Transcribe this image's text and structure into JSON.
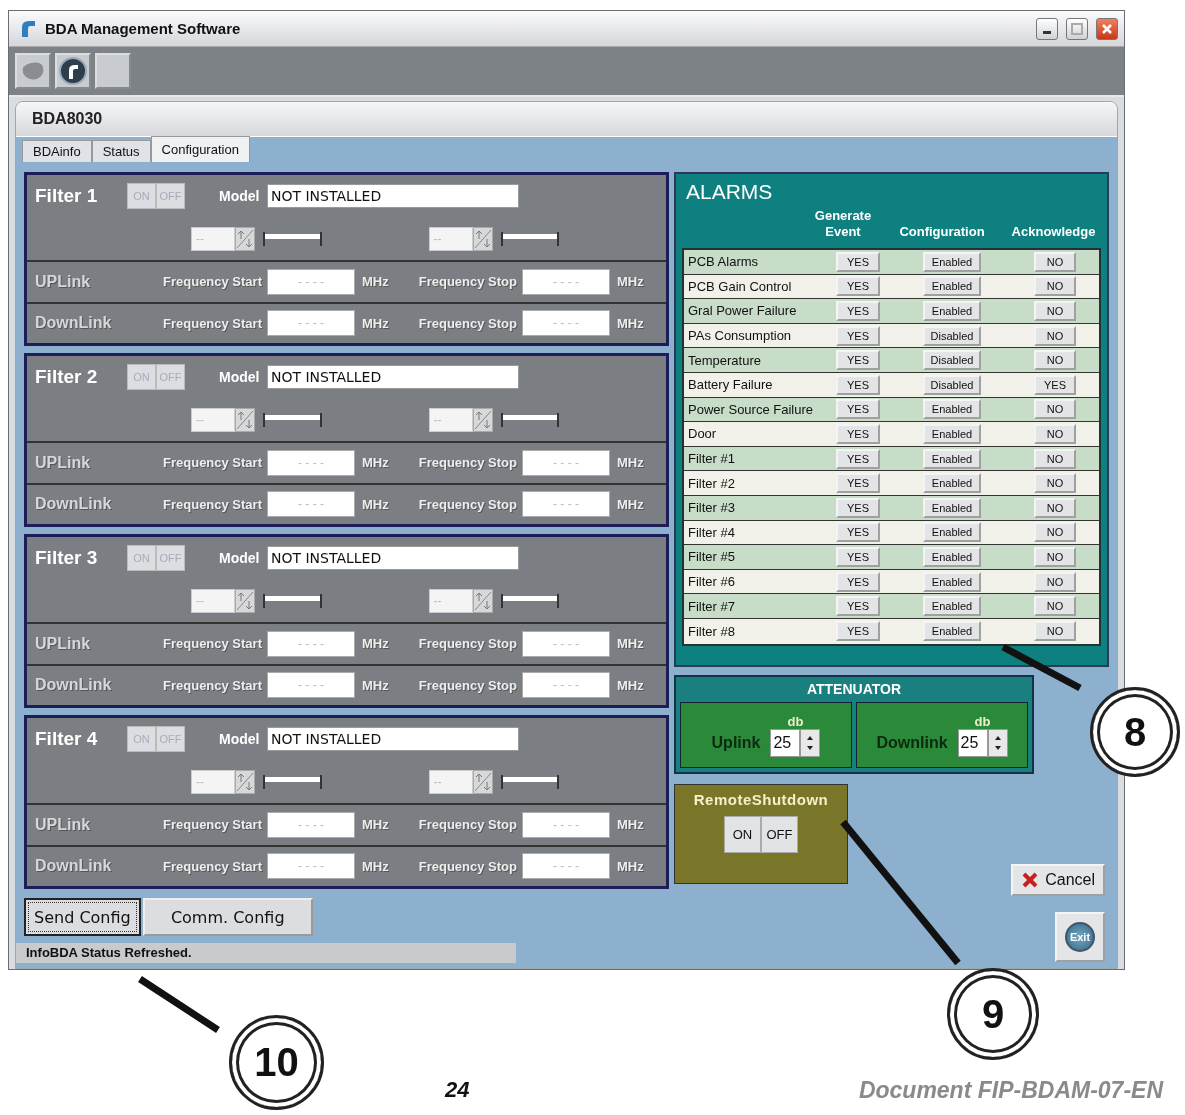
{
  "window": {
    "title": "BDA Management Software"
  },
  "form": {
    "title": "BDA8030"
  },
  "tabs": [
    {
      "label": "BDAinfo",
      "selected": false
    },
    {
      "label": "Status",
      "selected": false
    },
    {
      "label": "Configuration",
      "selected": true
    }
  ],
  "filters": [
    {
      "title": "Filter 1",
      "switch": [
        "ON",
        "OFF"
      ],
      "model_label": "Model",
      "model": "NOT INSTALLED",
      "spinners": [
        "--",
        "--"
      ],
      "links": [
        {
          "label": "UPLink",
          "start_label": "Frequency Start",
          "start": "- - - -",
          "start_unit": "MHz",
          "stop_label": "Frequency Stop",
          "stop": "- - - -",
          "stop_unit": "MHz"
        },
        {
          "label": "DownLink",
          "start_label": "Frequency Start",
          "start": "- - - -",
          "start_unit": "MHz",
          "stop_label": "Frequency Stop",
          "stop": "- - - -",
          "stop_unit": "MHz"
        }
      ]
    },
    {
      "title": "Filter 2",
      "switch": [
        "ON",
        "OFF"
      ],
      "model_label": "Model",
      "model": "NOT INSTALLED",
      "spinners": [
        "--",
        "--"
      ],
      "links": [
        {
          "label": "UPLink",
          "start_label": "Frequency Start",
          "start": "- - - -",
          "start_unit": "MHz",
          "stop_label": "Frequency Stop",
          "stop": "- - - -",
          "stop_unit": "MHz"
        },
        {
          "label": "DownLink",
          "start_label": "Frequency Start",
          "start": "- - - -",
          "start_unit": "MHz",
          "stop_label": "Frequency Stop",
          "stop": "- - - -",
          "stop_unit": "MHz"
        }
      ]
    },
    {
      "title": "Filter 3",
      "switch": [
        "ON",
        "OFF"
      ],
      "model_label": "Model",
      "model": "NOT INSTALLED",
      "spinners": [
        "--",
        "--"
      ],
      "links": [
        {
          "label": "UPLink",
          "start_label": "Frequency Start",
          "start": "- - - -",
          "start_unit": "MHz",
          "stop_label": "Frequency Stop",
          "stop": "- - - -",
          "stop_unit": "MHz"
        },
        {
          "label": "DownLink",
          "start_label": "Frequency Start",
          "start": "- - - -",
          "start_unit": "MHz",
          "stop_label": "Frequency Stop",
          "stop": "- - - -",
          "stop_unit": "MHz"
        }
      ]
    },
    {
      "title": "Filter 4",
      "switch": [
        "ON",
        "OFF"
      ],
      "model_label": "Model",
      "model": "NOT INSTALLED",
      "spinners": [
        "--",
        "--"
      ],
      "links": [
        {
          "label": "UPLink",
          "start_label": "Frequency Start",
          "start": "- - - -",
          "start_unit": "MHz",
          "stop_label": "Frequency Stop",
          "stop": "- - - -",
          "stop_unit": "MHz"
        },
        {
          "label": "DownLink",
          "start_label": "Frequency Start",
          "start": "- - - -",
          "start_unit": "MHz",
          "stop_label": "Frequency Stop",
          "stop": "- - - -",
          "stop_unit": "MHz"
        }
      ]
    }
  ],
  "alarms": {
    "title": "ALARMS",
    "columns": [
      "Generate Event",
      "Configuration",
      "Acknowledge"
    ],
    "rows": [
      {
        "name": "PCB Alarms",
        "generate": "YES",
        "configuration": "Enabled",
        "acknowledge": "NO"
      },
      {
        "name": "PCB Gain Control",
        "generate": "YES",
        "configuration": "Enabled",
        "acknowledge": "NO"
      },
      {
        "name": "Gral Power Failure",
        "generate": "YES",
        "configuration": "Enabled",
        "acknowledge": "NO"
      },
      {
        "name": "PAs Consumption",
        "generate": "YES",
        "configuration": "Disabled",
        "acknowledge": "NO"
      },
      {
        "name": "Temperature",
        "generate": "YES",
        "configuration": "Disabled",
        "acknowledge": "NO"
      },
      {
        "name": "Battery Failure",
        "generate": "YES",
        "configuration": "Disabled",
        "acknowledge": "YES"
      },
      {
        "name": "Power Source Failure",
        "generate": "YES",
        "configuration": "Enabled",
        "acknowledge": "NO"
      },
      {
        "name": "Door",
        "generate": "YES",
        "configuration": "Enabled",
        "acknowledge": "NO"
      },
      {
        "name": "Filter #1",
        "generate": "YES",
        "configuration": "Enabled",
        "acknowledge": "NO"
      },
      {
        "name": "Filter #2",
        "generate": "YES",
        "configuration": "Enabled",
        "acknowledge": "NO"
      },
      {
        "name": "Filter #3",
        "generate": "YES",
        "configuration": "Enabled",
        "acknowledge": "NO"
      },
      {
        "name": "Filter #4",
        "generate": "YES",
        "configuration": "Enabled",
        "acknowledge": "NO"
      },
      {
        "name": "Filter #5",
        "generate": "YES",
        "configuration": "Enabled",
        "acknowledge": "NO"
      },
      {
        "name": "Filter #6",
        "generate": "YES",
        "configuration": "Enabled",
        "acknowledge": "NO"
      },
      {
        "name": "Filter #7",
        "generate": "YES",
        "configuration": "Enabled",
        "acknowledge": "NO"
      },
      {
        "name": "Filter #8",
        "generate": "YES",
        "configuration": "Enabled",
        "acknowledge": "NO"
      }
    ]
  },
  "attenuator": {
    "title": "ATTENUATOR",
    "channels": [
      {
        "label": "Uplink",
        "unit": "db",
        "value": "25"
      },
      {
        "label": "Downlink",
        "unit": "db",
        "value": "25"
      }
    ]
  },
  "remote_shutdown": {
    "title": "RemoteShutdown",
    "buttons": [
      "ON",
      "OFF"
    ]
  },
  "buttons": {
    "cancel": "Cancel",
    "exit": "Exit",
    "send": "Send Config",
    "comm": "Comm. Config"
  },
  "status_bar": "InfoBDA Status Refreshed.",
  "callouts": [
    "8",
    "9",
    "10"
  ],
  "footer": {
    "page": "24",
    "document": "Document FIP-BDAM-07-EN"
  }
}
